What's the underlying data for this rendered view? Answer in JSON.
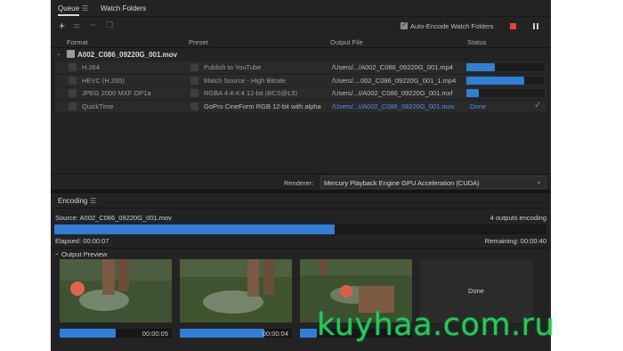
{
  "tabs": {
    "queue": "Queue",
    "watch": "Watch Folders"
  },
  "toolbar": {
    "auto_encode": "Auto-Encode Watch Folders"
  },
  "columns": {
    "format": "Format",
    "preset": "Preset",
    "output": "Output File",
    "status": "Status"
  },
  "source_item": {
    "name": "A002_C086_09220G_001.mov"
  },
  "outputs": [
    {
      "format": "H.264",
      "preset": "Publish to YouTube",
      "output": "/Users/.../A002_C086_09220G_001.mp4",
      "status": "",
      "progress": 0.36
    },
    {
      "format": "HEVC (H.265)",
      "preset": "Match Source - High Bitrate",
      "output": "/Users/....002_C086_09220G_001_1.mp4",
      "status": "",
      "progress": 0.74
    },
    {
      "format": "JPEG 2000 MXF OP1a",
      "preset": "RGBA 4:4:4:4 12-bit (BCS@L5)",
      "output": "/Users/...t/A002_C086_09220G_001.mxf",
      "status": "",
      "progress": 0.16
    },
    {
      "format": "QuickTime",
      "preset": "GoPro CineForm RGB 12-bit with alpha",
      "output": "/Users/...t/A002_C086_09220G_001.mov",
      "status": "Done",
      "progress": 1
    }
  ],
  "renderer": {
    "label": "Renderer:",
    "value": "Mercury Playback Engine GPU Acceleration (CUDA)"
  },
  "encoding": {
    "title": "Encoding",
    "source": "Source: A002_C086_09220G_001.mov",
    "count": "4 outputs encoding",
    "progress": 0.57,
    "elapsed": "Elapsed: 00:00:07",
    "remaining": "Remaining: 00:00:40",
    "preview_label": "Output Preview"
  },
  "previews": [
    {
      "time": "00:00:05",
      "progress": 0.5
    },
    {
      "time": "00:00:04",
      "progress": 0.75
    },
    {
      "time": "",
      "progress": 0.15
    },
    {
      "time": "",
      "done": "Done"
    }
  ],
  "watermark": "kuyhaa.com.ru",
  "colors": {
    "accent": "#2f7fd8",
    "stop": "#e0453a",
    "check": "#3cb44a",
    "watermark": "#25c95b"
  }
}
